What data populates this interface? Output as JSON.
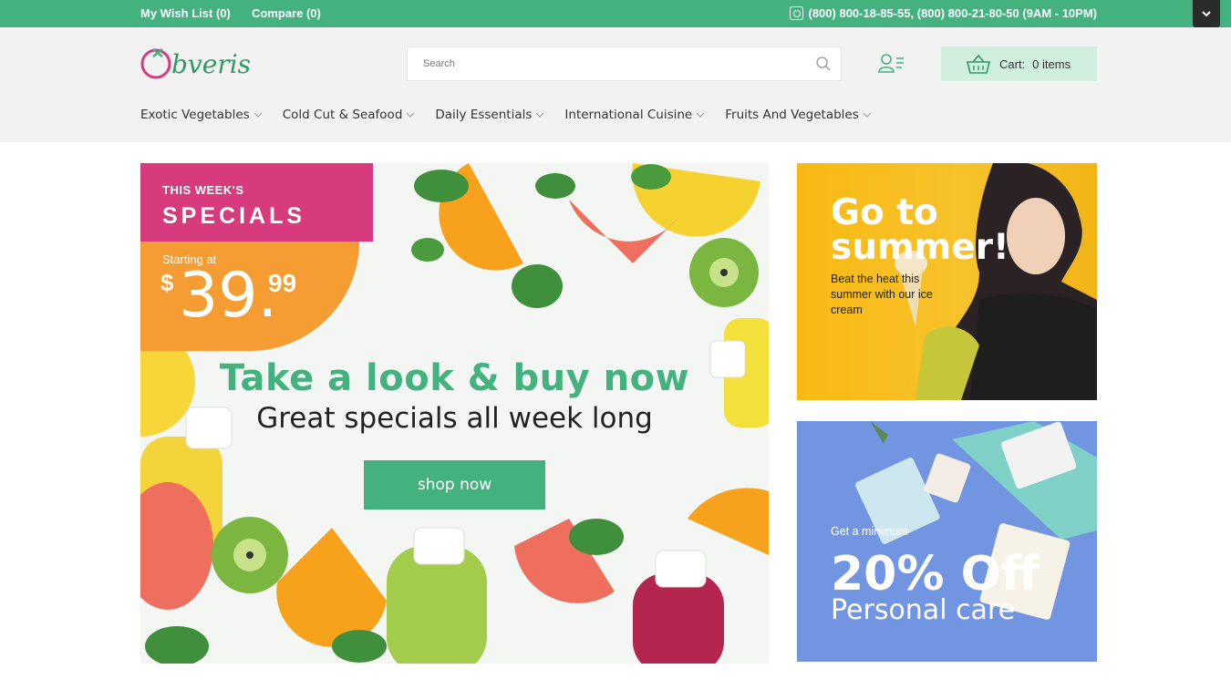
{
  "topbar": {
    "wishlist": "My Wish List (0)",
    "compare": "Compare (0)",
    "phones": "(800) 800-18-85-55, (800) 800-21-80-50 (9AM - 10PM)",
    "toggle_icon": "chevron-down-icon",
    "bg_color": "#43b27f"
  },
  "header": {
    "logo_text": "Obveris",
    "search": {
      "placeholder": "Search",
      "icon": "search-icon"
    },
    "account_icon": "account-icon",
    "cart": {
      "label": "Cart:",
      "count": "0 items",
      "icon": "basket-icon"
    }
  },
  "nav": {
    "items": [
      {
        "label": "Exotic Vegetables"
      },
      {
        "label": "Cold Cut & Seafood"
      },
      {
        "label": "Daily Essentials"
      },
      {
        "label": "International Cuisine"
      },
      {
        "label": "Fruits And Vegetables"
      }
    ]
  },
  "hero": {
    "tag_small": "THIS WEEK'S",
    "tag_large": "SPECIALS",
    "starting": "Starting at",
    "currency": "$",
    "price_main": "39.",
    "price_cents": "99",
    "title": "Take a look & buy now",
    "subtitle": "Great specials all week long",
    "button": "shop now"
  },
  "banners": {
    "summer": {
      "title": "Go to summer!",
      "desc": "Beat the heat this summer with our ice cream"
    },
    "care": {
      "small": "Get a minimum",
      "big": "20% Off",
      "sub": "Personal care"
    }
  },
  "colors": {
    "accent": "#43b27f",
    "pink": "#d83a7e",
    "orange": "#f59c32",
    "yellow": "#f8b913",
    "blue": "#7295e2"
  }
}
